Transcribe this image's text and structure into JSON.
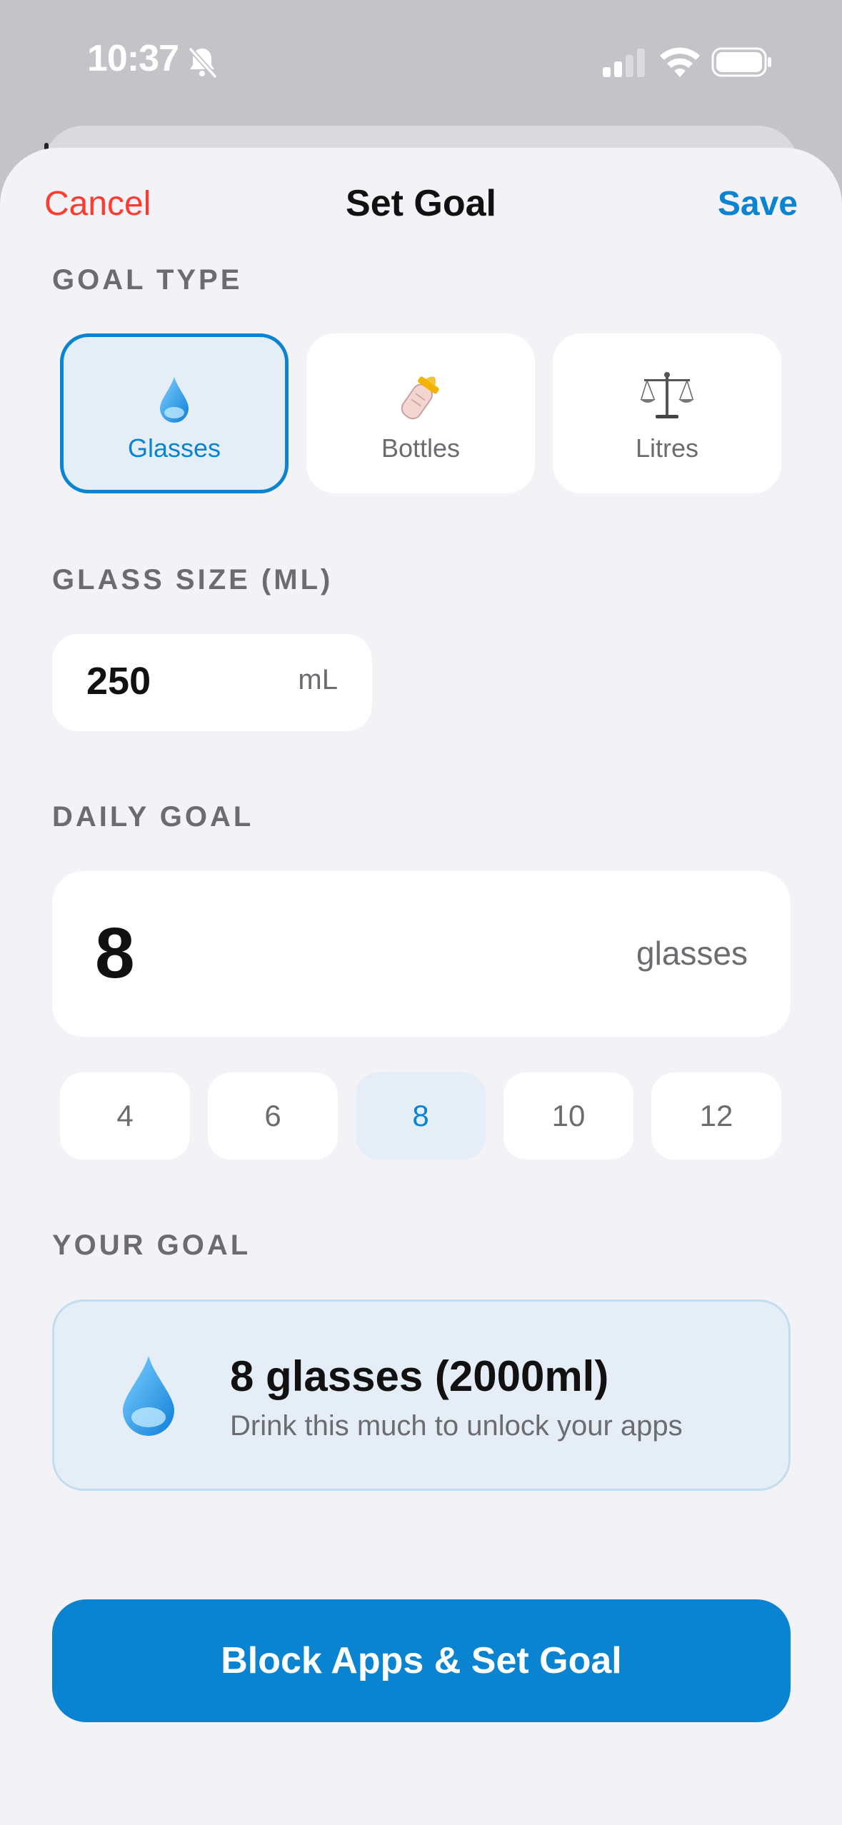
{
  "status_bar": {
    "time": "10:37"
  },
  "nav": {
    "cancel": "Cancel",
    "title": "Set Goal",
    "save": "Save"
  },
  "goal_type": {
    "label": "GOAL TYPE",
    "options": [
      {
        "label": "Glasses",
        "icon": "water-drop-icon",
        "selected": true
      },
      {
        "label": "Bottles",
        "icon": "baby-bottle-icon",
        "selected": false
      },
      {
        "label": "Litres",
        "icon": "balance-scale-icon",
        "selected": false
      }
    ]
  },
  "glass_size": {
    "label": "GLASS SIZE (ML)",
    "value": "250",
    "unit": "mL"
  },
  "daily_goal": {
    "label": "DAILY GOAL",
    "value": "8",
    "unit": "glasses",
    "presets": [
      "4",
      "6",
      "8",
      "10",
      "12"
    ],
    "selected_preset": "8"
  },
  "your_goal": {
    "label": "YOUR GOAL",
    "title": "8 glasses (2000ml)",
    "subtitle": "Drink this much to unlock your apps",
    "icon": "water-drop-icon"
  },
  "cta": {
    "label": "Block Apps & Set Goal"
  },
  "colors": {
    "accent": "#0a84d0",
    "destructive": "#ff3b30",
    "background": "#f2f2f7"
  }
}
